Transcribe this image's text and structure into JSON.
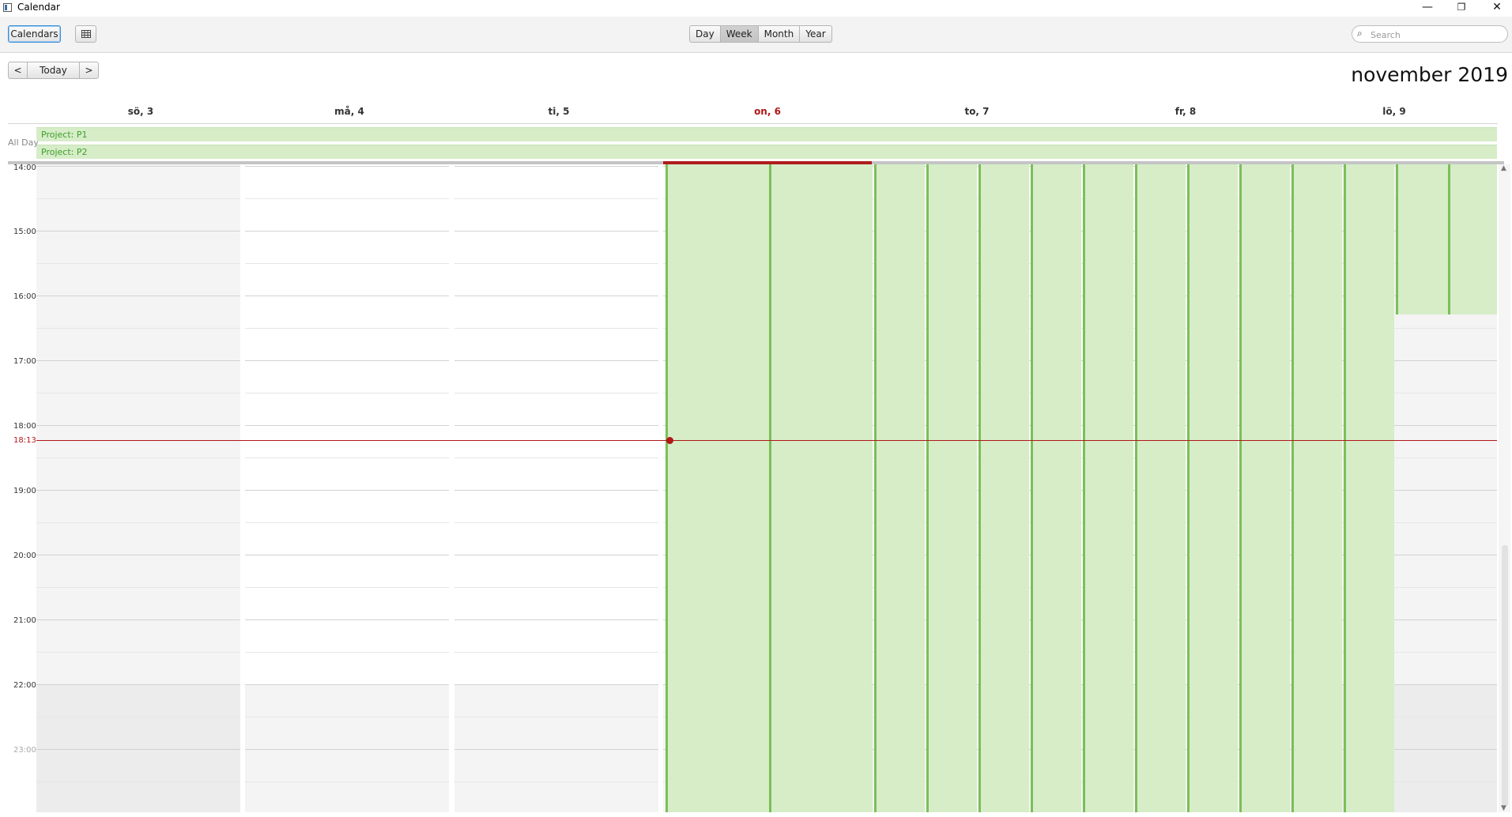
{
  "window": {
    "title": "Calendar",
    "minimize": "—",
    "restore": "❐",
    "close": "✕"
  },
  "toolbar": {
    "calendars_label": "Calendars",
    "grid_icon": "grid-icon",
    "views": [
      "Day",
      "Week",
      "Month",
      "Year"
    ],
    "active_view": "Week",
    "search_placeholder": "Search"
  },
  "nav": {
    "prev": "<",
    "today": "Today",
    "next": ">"
  },
  "month_title": "november 2019",
  "days": [
    {
      "label": "sö, 3",
      "today": false
    },
    {
      "label": "må, 4",
      "today": false
    },
    {
      "label": "ti, 5",
      "today": false
    },
    {
      "label": "on, 6",
      "today": true
    },
    {
      "label": "to, 7",
      "today": false
    },
    {
      "label": "fr, 8",
      "today": false
    },
    {
      "label": "lö, 9",
      "today": false
    }
  ],
  "all_day": {
    "label": "All Day",
    "events": [
      "Project: P1",
      "Project: P2"
    ]
  },
  "hours": [
    "14:00",
    "15:00",
    "16:00",
    "17:00",
    "18:00",
    "19:00",
    "20:00",
    "21:00",
    "22:00",
    "23:00"
  ],
  "now_time": "18:13",
  "colors": {
    "accent_red": "#b01818",
    "event_fill": "#d6edc8",
    "event_border": "#7bbf57"
  }
}
